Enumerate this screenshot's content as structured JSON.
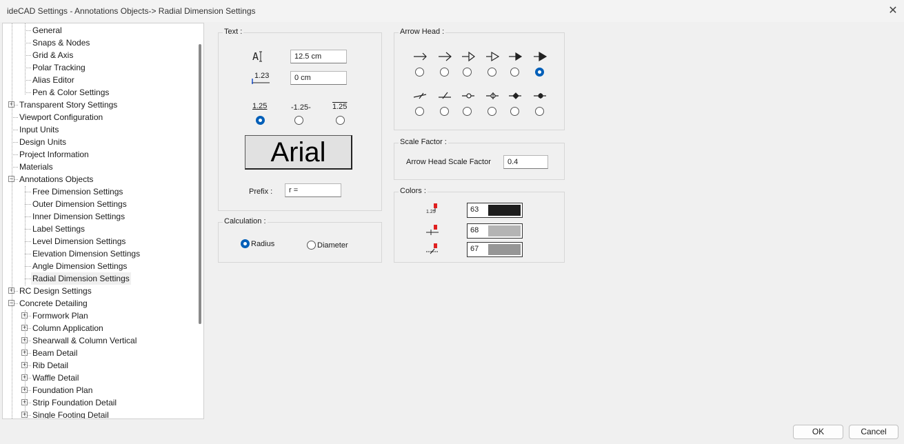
{
  "window": {
    "title": "ideCAD Settings - Annotations Objects-> Radial Dimension Settings",
    "close_glyph": "✕"
  },
  "tree": [
    {
      "label": "General",
      "level": 2
    },
    {
      "label": "Snaps & Nodes",
      "level": 2
    },
    {
      "label": "Grid & Axis",
      "level": 2
    },
    {
      "label": "Polar Tracking",
      "level": 2
    },
    {
      "label": "Alias Editor",
      "level": 2
    },
    {
      "label": "Pen & Color Settings",
      "level": 2
    },
    {
      "label": "Transparent Story Settings",
      "level": 1,
      "expander": "+"
    },
    {
      "label": "Viewport Configuration",
      "level": 1
    },
    {
      "label": "Input Units",
      "level": 1
    },
    {
      "label": "Design Units",
      "level": 1
    },
    {
      "label": "Project Information",
      "level": 1
    },
    {
      "label": "Materials",
      "level": 1
    },
    {
      "label": "Annotations Objects",
      "level": 1,
      "expander": "−"
    },
    {
      "label": "Free Dimension Settings",
      "level": 2
    },
    {
      "label": "Outer Dimension Settings",
      "level": 2
    },
    {
      "label": "Inner Dimension Settings",
      "level": 2
    },
    {
      "label": "Label Settings",
      "level": 2
    },
    {
      "label": "Level Dimension Settings",
      "level": 2
    },
    {
      "label": "Elevation Dimension Settings",
      "level": 2
    },
    {
      "label": "Angle Dimension Settings",
      "level": 2
    },
    {
      "label": "Radial Dimension Settings",
      "level": 2,
      "selected": true
    },
    {
      "label": "RC Design Settings",
      "level": 1,
      "expander": "+"
    },
    {
      "label": "Concrete Detailing",
      "level": 1,
      "expander": "−"
    },
    {
      "label": "Formwork Plan",
      "level": 2,
      "expander": "+"
    },
    {
      "label": "Column Application",
      "level": 2,
      "expander": "+"
    },
    {
      "label": "Shearwall & Column Vertical",
      "level": 2,
      "expander": "+"
    },
    {
      "label": "Beam Detail",
      "level": 2,
      "expander": "+"
    },
    {
      "label": "Rib Detail",
      "level": 2,
      "expander": "+"
    },
    {
      "label": "Waffle Detail",
      "level": 2,
      "expander": "+"
    },
    {
      "label": "Foundation Plan",
      "level": 2,
      "expander": "+"
    },
    {
      "label": "Strip Foundation Detail",
      "level": 2,
      "expander": "+"
    },
    {
      "label": "Single Footing Detail",
      "level": 2,
      "expander": "+"
    }
  ],
  "text_group": {
    "label": "Text :",
    "text_height": "12.5 cm",
    "text_offset": "0 cm",
    "offset_icon_label": "1.23",
    "position_options": [
      "1.25",
      "-1.25-",
      "1.25"
    ],
    "position_selected": 0,
    "font_name": "Arial",
    "prefix_label": "Prefix :",
    "prefix_value": "r ="
  },
  "calculation": {
    "label": "Calculation :",
    "options": [
      "Radius",
      "Diameter"
    ],
    "selected": 0
  },
  "arrow_head": {
    "label": "Arrow Head :",
    "selected_row": 0,
    "selected_col": 5
  },
  "scale": {
    "label": "Scale Factor :",
    "field_label": "Arrow Head Scale Factor",
    "value": "0.4"
  },
  "colors": {
    "label": "Colors :",
    "icon_label": "1.25",
    "items": [
      {
        "number": "63",
        "color": "#1e1e1e"
      },
      {
        "number": "68",
        "color": "#b4b4b4"
      },
      {
        "number": "67",
        "color": "#969696"
      }
    ]
  },
  "footer": {
    "ok": "OK",
    "cancel": "Cancel"
  }
}
